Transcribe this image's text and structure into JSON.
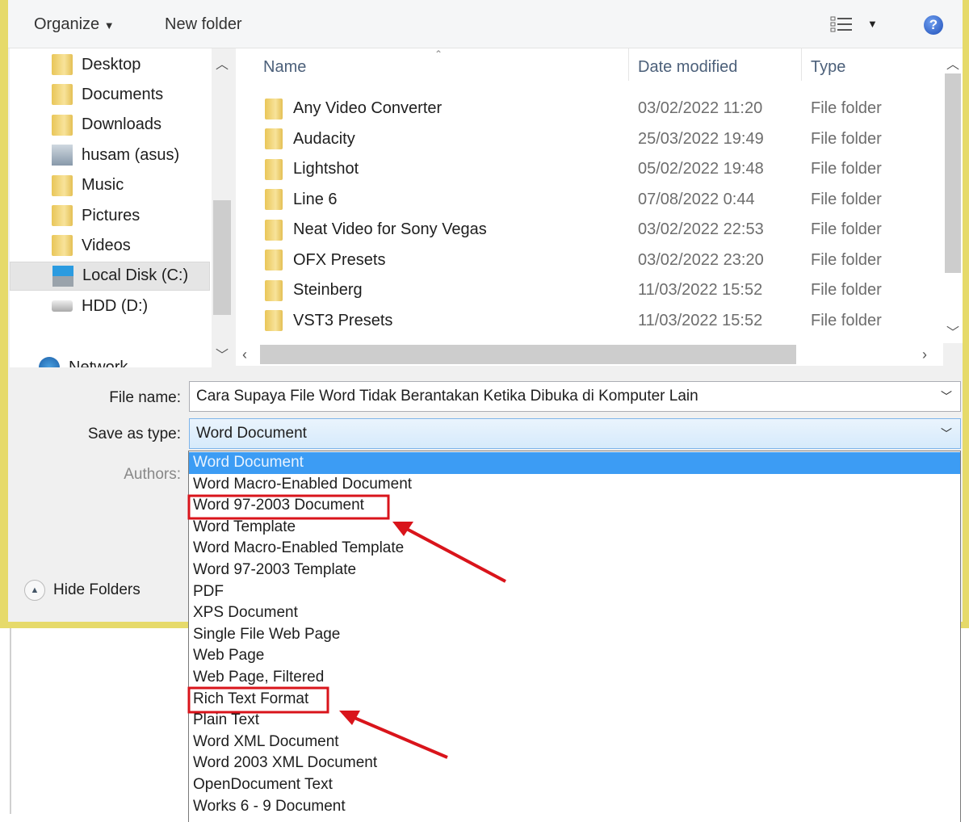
{
  "toolbar": {
    "organize": "Organize",
    "new_folder": "New folder"
  },
  "nav": {
    "items": [
      {
        "label": "Desktop",
        "icon": "desktop-folder-icon"
      },
      {
        "label": "Documents",
        "icon": "documents-folder-icon"
      },
      {
        "label": "Downloads",
        "icon": "downloads-folder-icon"
      },
      {
        "label": "husam (asus)",
        "icon": "user-icon"
      },
      {
        "label": "Music",
        "icon": "music-folder-icon"
      },
      {
        "label": "Pictures",
        "icon": "pictures-folder-icon"
      },
      {
        "label": "Videos",
        "icon": "videos-folder-icon"
      },
      {
        "label": "Local Disk (C:)",
        "icon": "local-disk-icon",
        "selected": true
      },
      {
        "label": "HDD (D:)",
        "icon": "drive-icon"
      },
      {
        "label": "Network",
        "icon": "network-icon"
      }
    ]
  },
  "list": {
    "columns": [
      "Name",
      "Date modified",
      "Type"
    ],
    "rows": [
      {
        "name": "Any Video Converter",
        "date": "03/02/2022 11:20",
        "type": "File folder"
      },
      {
        "name": "Audacity",
        "date": "25/03/2022 19:49",
        "type": "File folder"
      },
      {
        "name": "Lightshot",
        "date": "05/02/2022 19:48",
        "type": "File folder"
      },
      {
        "name": "Line 6",
        "date": "07/08/2022 0:44",
        "type": "File folder"
      },
      {
        "name": "Neat Video for Sony Vegas",
        "date": "03/02/2022 22:53",
        "type": "File folder"
      },
      {
        "name": "OFX Presets",
        "date": "03/02/2022 23:20",
        "type": "File folder"
      },
      {
        "name": "Steinberg",
        "date": "11/03/2022 15:52",
        "type": "File folder"
      },
      {
        "name": "VST3 Presets",
        "date": "11/03/2022 15:52",
        "type": "File folder"
      }
    ]
  },
  "form": {
    "file_name_label": "File name:",
    "file_name": "Cara Supaya File Word Tidak Berantakan Ketika Dibuka di Komputer Lain",
    "save_type_label": "Save as type:",
    "save_type": "Word Document",
    "authors_label": "Authors:",
    "hide_folders": "Hide Folders"
  },
  "dropdown": {
    "options": [
      "Word Document",
      "Word Macro-Enabled Document",
      "Word 97-2003 Document",
      "Word Template",
      "Word Macro-Enabled Template",
      "Word 97-2003 Template",
      "PDF",
      "XPS Document",
      "Single File Web Page",
      "Web Page",
      "Web Page, Filtered",
      "Rich Text Format",
      "Plain Text",
      "Word XML Document",
      "Word 2003 XML Document",
      "OpenDocument Text",
      "Works 6 - 9 Document"
    ],
    "highlighted": "Word Document",
    "annotated": [
      "Word 97-2003 Document",
      "Rich Text Format"
    ]
  },
  "colors": {
    "highlight": "#3c9cf4",
    "annotation": "#d9141b",
    "frame": "#e6da6a"
  }
}
